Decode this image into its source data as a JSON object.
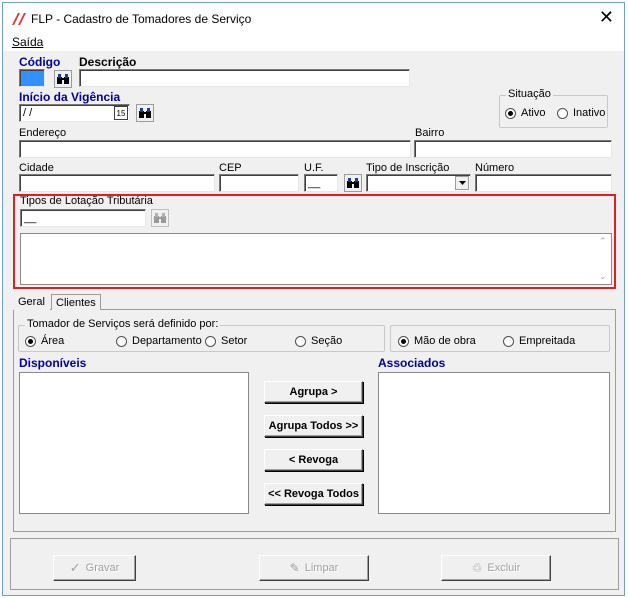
{
  "window": {
    "title": "FLP - Cadastro de Tomadores de Serviço",
    "close_glyph": "✕"
  },
  "menu": {
    "items": [
      {
        "label": "Saída",
        "mnemonic_index": 0
      }
    ]
  },
  "form": {
    "codigo_label": "Código",
    "codigo_value": "",
    "descricao_label": "Descrição",
    "descricao_value": "",
    "inicio_vigencia_label": "Início da Vigência",
    "inicio_vigencia_value": " / /",
    "situacao_label": "Situação",
    "situacao_options": [
      {
        "label": "Ativo",
        "checked": true
      },
      {
        "label": "Inativo",
        "checked": false
      }
    ],
    "endereco_label": "Endereço",
    "endereco_value": "",
    "bairro_label": "Bairro",
    "bairro_value": "",
    "cidade_label": "Cidade",
    "cidade_value": "",
    "cep_label": "CEP",
    "cep_value": "",
    "uf_label": "U.F.",
    "uf_value": "__",
    "tipo_inscricao_label": "Tipo de Inscrição",
    "tipo_inscricao_value": "",
    "numero_label": "Número",
    "numero_value": "",
    "lotacao_label": "Tipos de Lotação Tributária",
    "lotacao_value": "__",
    "lotacao_memo": ""
  },
  "tabs": [
    {
      "label": "Geral",
      "active": true
    },
    {
      "label": "Clientes",
      "active": false
    }
  ],
  "geral": {
    "tomador_group_label": "Tomador de Serviços será definido por:",
    "tomador_options": [
      {
        "label": "Área",
        "checked": true
      },
      {
        "label": "Departamento",
        "checked": false
      },
      {
        "label": "Setor",
        "checked": false
      },
      {
        "label": "Seção",
        "checked": false
      }
    ],
    "tipo_options": [
      {
        "label": "Mão de obra",
        "checked": true
      },
      {
        "label": "Empreitada",
        "checked": false
      }
    ],
    "disponiveis_label": "Disponíveis",
    "associados_label": "Associados",
    "buttons": {
      "agrupa": "Agrupa >",
      "agrupa_todos": "Agrupa Todos >>",
      "revoga": "< Revoga",
      "revoga_todos": "<< Revoga Todos"
    }
  },
  "footer": {
    "gravar": "Gravar",
    "limpar": "Limpar",
    "excluir": "Excluir"
  },
  "colors": {
    "accent_blue": "#0000a0",
    "highlight_red": "#e02020",
    "selection_blue": "#3390ff"
  }
}
